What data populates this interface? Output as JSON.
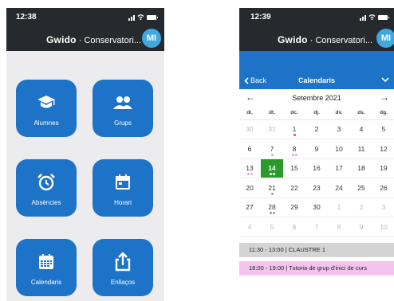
{
  "left_screen": {
    "status": {
      "time": "12:38"
    },
    "header": {
      "brand": "Gwido",
      "separator": "·",
      "subtitle": "Conservatori...",
      "avatar": "MI"
    },
    "tiles": [
      {
        "label": "Alumnes",
        "icon": "graduation-cap-icon"
      },
      {
        "label": "Grups",
        "icon": "group-icon"
      },
      {
        "label": "Absències",
        "icon": "alarm-clock-icon"
      },
      {
        "label": "Horari",
        "icon": "calendar-icon"
      },
      {
        "label": "Calendaris",
        "icon": "calendar-grid-icon"
      },
      {
        "label": "Enllaços",
        "icon": "share-upload-icon"
      }
    ]
  },
  "right_screen": {
    "status": {
      "time": "12:39"
    },
    "header": {
      "brand": "Gwido",
      "separator": "·",
      "subtitle": "Conservatori...",
      "avatar": "MI"
    },
    "nav": {
      "back": "Back",
      "title": "Calendaris"
    },
    "calendar": {
      "month": "Setembre 2021",
      "weekdays": [
        "dl.",
        "dt.",
        "dc.",
        "dj.",
        "dv.",
        "ds.",
        "dg."
      ],
      "weeks": [
        [
          {
            "day": "30",
            "muted": true
          },
          {
            "day": "31",
            "muted": true
          },
          {
            "day": "1",
            "dots": [
              "#e0457b"
            ]
          },
          {
            "day": "2"
          },
          {
            "day": "3"
          },
          {
            "day": "4"
          },
          {
            "day": "5"
          }
        ],
        [
          {
            "day": "6"
          },
          {
            "day": "7",
            "dots": [
              "#b9b9c9"
            ]
          },
          {
            "day": "8",
            "dots": [
              "#e7a6e5",
              "#e7a6e5"
            ]
          },
          {
            "day": "9"
          },
          {
            "day": "10"
          },
          {
            "day": "11"
          },
          {
            "day": "12"
          }
        ],
        [
          {
            "day": "13",
            "dots": [
              "#e7a6e5",
              "#e7a6e5"
            ]
          },
          {
            "day": "14",
            "today": true,
            "dots": [
              "#ffffff",
              "#ffffff"
            ]
          },
          {
            "day": "15"
          },
          {
            "day": "16"
          },
          {
            "day": "17"
          },
          {
            "day": "18"
          },
          {
            "day": "19"
          }
        ],
        [
          {
            "day": "20"
          },
          {
            "day": "21",
            "dots": [
              "#9a9aa8"
            ]
          },
          {
            "day": "22"
          },
          {
            "day": "23"
          },
          {
            "day": "24"
          },
          {
            "day": "25"
          },
          {
            "day": "26"
          }
        ],
        [
          {
            "day": "27"
          },
          {
            "day": "28",
            "dots": [
              "#9a9aa8",
              "#9a9aa8"
            ]
          },
          {
            "day": "29"
          },
          {
            "day": "30"
          },
          {
            "day": "1",
            "muted": true
          },
          {
            "day": "2",
            "muted": true
          },
          {
            "day": "3",
            "muted": true
          }
        ],
        [
          {
            "day": "4",
            "muted": true
          },
          {
            "day": "5",
            "muted": true
          },
          {
            "day": "6",
            "muted": true
          },
          {
            "day": "7",
            "muted": true
          },
          {
            "day": "8",
            "muted": true
          },
          {
            "day": "9",
            "muted": true
          },
          {
            "day": "10",
            "muted": true
          }
        ]
      ]
    },
    "events": [
      {
        "text": "11:30 - 13:00 | CLAUSTRE 1",
        "color": "#d4d4d4"
      },
      {
        "text": "18:00 - 19:00 | Tutoria de grup d'inici de curs",
        "color": "#f4c4ef"
      }
    ]
  },
  "colors": {
    "header_dark": "#262a2e",
    "accent_blue": "#1c73c7",
    "avatar_blue": "#3fa8de",
    "today_green": "#2a9b2a"
  }
}
